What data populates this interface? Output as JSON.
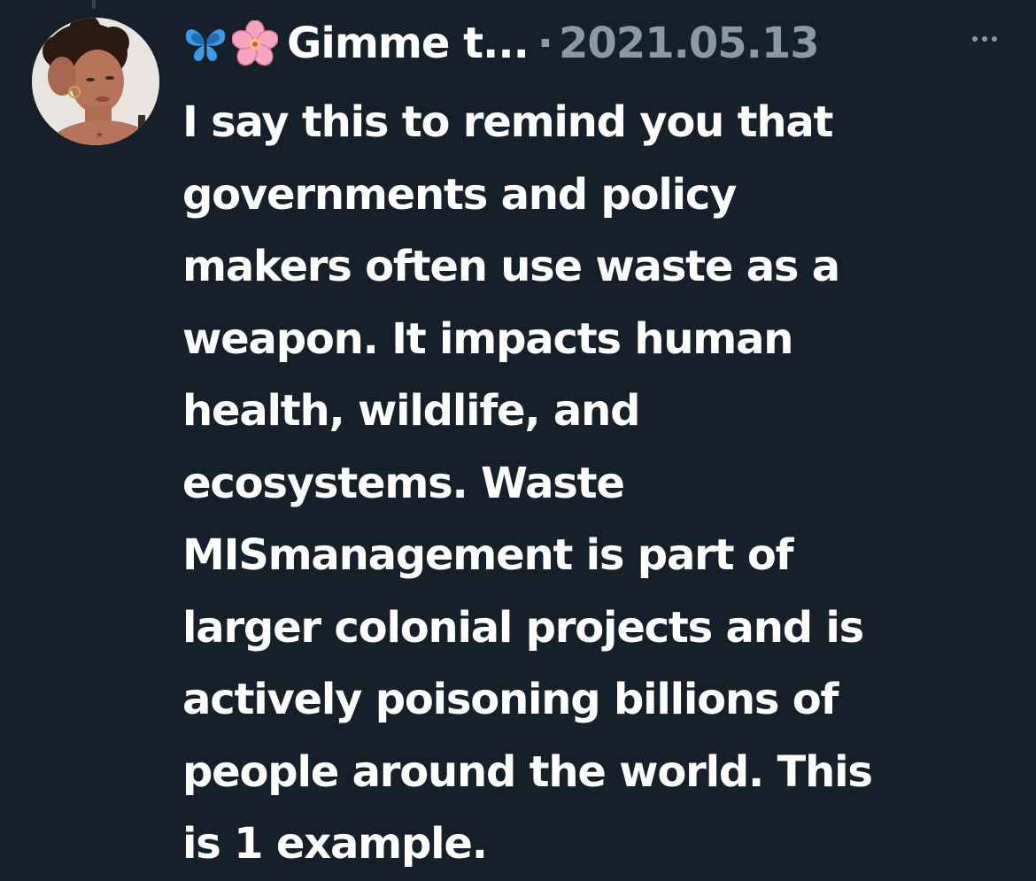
{
  "tweet": {
    "display_name": "Gimme t...",
    "separator": "·",
    "timestamp": "2021.05.13",
    "lines": [
      "I say this to remind you that",
      "governments and policy",
      "makers often use waste as a",
      "weapon. It impacts human",
      "health, wildlife, and",
      "ecosystems. Waste",
      "MISmanagement is part of",
      "larger colonial projects and is",
      "actively poisoning billions of",
      "people around the world. This",
      "is 1 example."
    ]
  },
  "icons": {
    "name_emoji_1": "butterfly-icon",
    "name_emoji_2": "cherry-blossom-icon",
    "more": "more-horizontal-icon"
  },
  "colors": {
    "background": "#15202b",
    "text": "#ffffff",
    "secondary_text": "#8b98a5",
    "butterfly": "#3b9be8",
    "blossom": "#f6a5c0"
  }
}
